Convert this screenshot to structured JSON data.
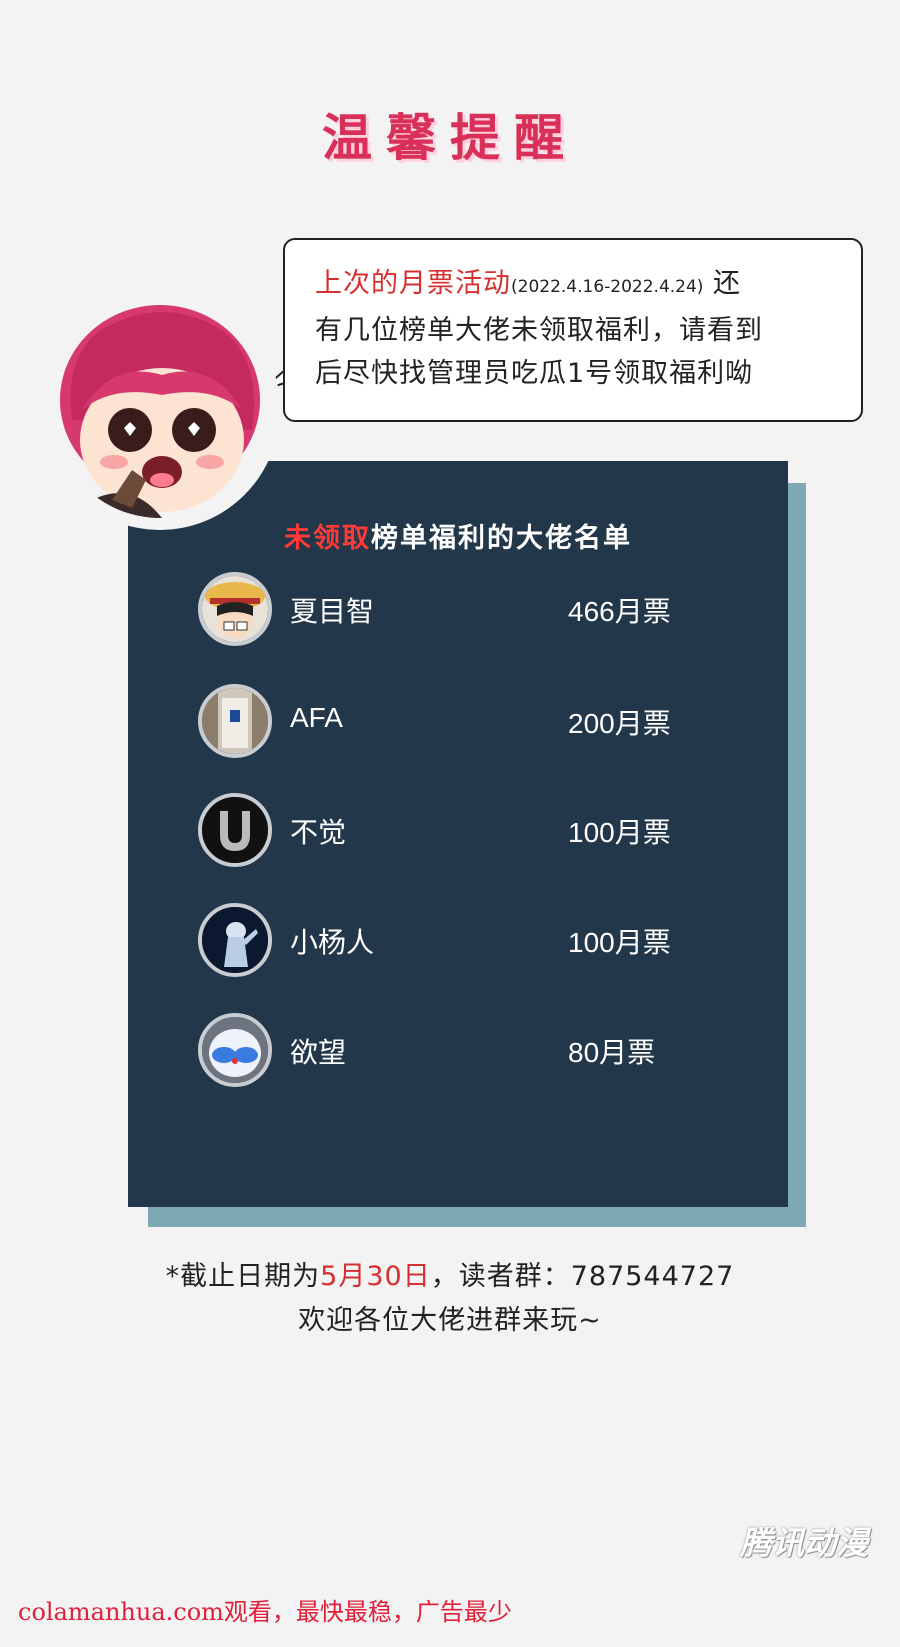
{
  "title": "温馨提醒",
  "bubble": {
    "highlight": "上次的月票活动",
    "dates": "(2022.4.16-2022.4.24)",
    "text_a": "还",
    "line2": "有几位榜单大佬未领取福利，请看到",
    "line3": "后尽快找管理员吃瓜1号领取福利呦"
  },
  "card": {
    "title_red": "未领取",
    "title_rest": "榜单福利的大佬名单",
    "entries": [
      {
        "name": "夏目智",
        "votes": "466月票"
      },
      {
        "name": "AFA",
        "votes": "200月票"
      },
      {
        "name": "不觉",
        "votes": "100月票"
      },
      {
        "name": "小杨人",
        "votes": "100月票"
      },
      {
        "name": "欲望",
        "votes": "80月票"
      }
    ]
  },
  "note": {
    "prefix": "*截止日期为",
    "date": "5月30日",
    "suffix": "，读者群：787544727",
    "line2": "欢迎各位大佬进群来玩~"
  },
  "watermark": "腾讯动漫",
  "footer": "colamanhua.com观看，最快最稳，广告最少"
}
